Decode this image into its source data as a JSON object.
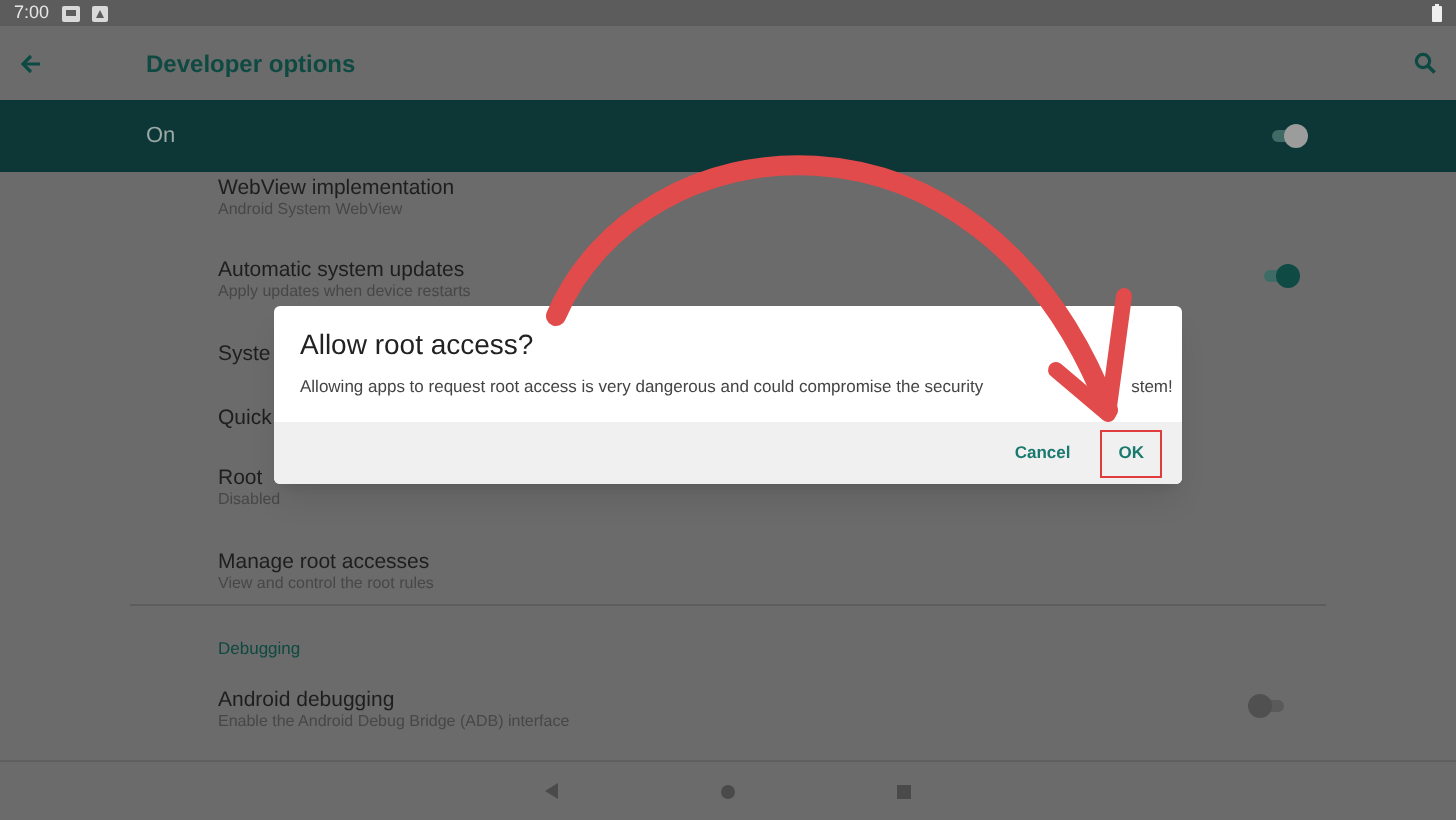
{
  "status_bar": {
    "time": "7:00"
  },
  "toolbar": {
    "title": "Developer options"
  },
  "master_switch": {
    "label": "On",
    "on": true
  },
  "settings": [
    {
      "kind": "plain",
      "title": "WebView implementation",
      "subtitle": "Android System WebView"
    },
    {
      "kind": "switch",
      "title": "Automatic system updates",
      "subtitle": "Apply updates when device restarts",
      "on": true
    },
    {
      "kind": "plain",
      "title": "Syste"
    },
    {
      "kind": "plain",
      "title": "Quick"
    },
    {
      "kind": "plain",
      "title": "Root",
      "subtitle": "Disabled"
    },
    {
      "kind": "plain",
      "title": "Manage root accesses",
      "subtitle": "View and control the root rules"
    }
  ],
  "debugging": {
    "header": "Debugging",
    "items": [
      {
        "kind": "switch",
        "title": "Android debugging",
        "subtitle": "Enable the Android Debug Bridge (ADB) interface",
        "on": false
      }
    ]
  },
  "dialog": {
    "title": "Allow root access?",
    "message": "Allowing apps to request root access is very dangerous and could compromise the security",
    "message_tail": "stem!",
    "buttons": [
      {
        "label": "Cancel",
        "highlighted": false
      },
      {
        "label": "OK",
        "highlighted": true
      }
    ]
  }
}
